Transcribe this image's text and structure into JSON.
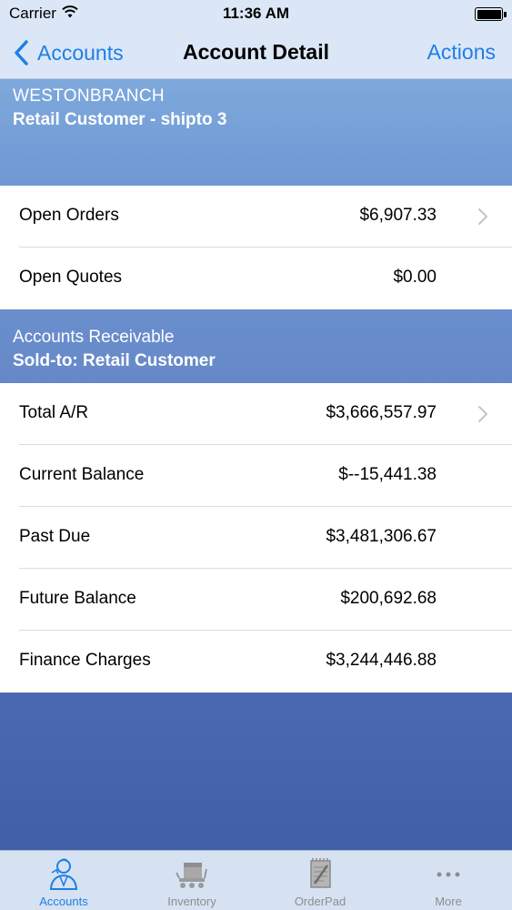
{
  "status_bar": {
    "carrier": "Carrier",
    "time": "11:36 AM"
  },
  "nav": {
    "back_label": "Accounts",
    "title": "Account Detail",
    "actions_label": "Actions"
  },
  "account": {
    "branch": "WESTONBRANCH",
    "customer": "Retail Customer - shipto 3"
  },
  "orders": [
    {
      "label": "Open Orders",
      "value": "$6,907.33",
      "has_disclosure": true
    },
    {
      "label": "Open Quotes",
      "value": "$0.00",
      "has_disclosure": false
    }
  ],
  "receivable_header": {
    "title": "Accounts Receivable",
    "subtitle": "Sold-to: Retail Customer"
  },
  "receivables": [
    {
      "label": "Total A/R",
      "value": "$3,666,557.97",
      "has_disclosure": true
    },
    {
      "label": "Current Balance",
      "value": "$--15,441.38",
      "has_disclosure": false
    },
    {
      "label": "Past Due",
      "value": "$3,481,306.67",
      "has_disclosure": false
    },
    {
      "label": "Future Balance",
      "value": "$200,692.68",
      "has_disclosure": false
    },
    {
      "label": "Finance Charges",
      "value": "$3,244,446.88",
      "has_disclosure": false
    }
  ],
  "tabs": [
    {
      "label": "Accounts",
      "icon": "accounts-icon",
      "active": true
    },
    {
      "label": "Inventory",
      "icon": "inventory-icon",
      "active": false
    },
    {
      "label": "OrderPad",
      "icon": "orderpad-icon",
      "active": false
    },
    {
      "label": "More",
      "icon": "more-icon",
      "active": false
    }
  ],
  "colors": {
    "accent": "#1e7ee6",
    "tab_inactive": "#8d8d8d",
    "header_blue": "#7ea9dc"
  }
}
